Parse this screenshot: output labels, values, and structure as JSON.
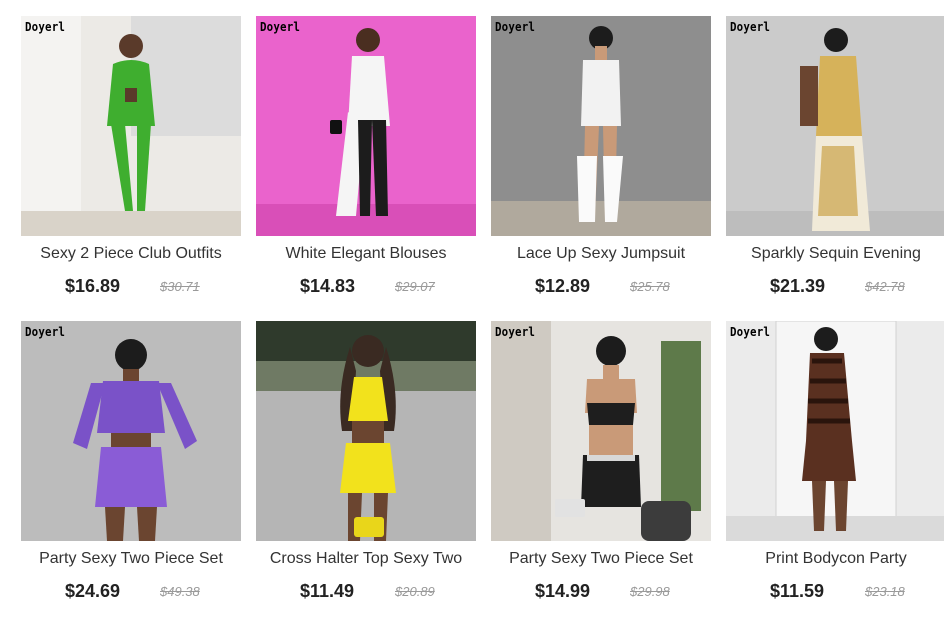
{
  "products": [
    {
      "brand": "Doyerl",
      "title": "Sexy 2 Piece Club Outfits",
      "price": "$16.89",
      "old_price": "$30.71",
      "bg": "#e8e6e3",
      "accent": "#3fae2f",
      "skin": "#5a3a2a"
    },
    {
      "brand": "Doyerl",
      "title": "White Elegant Blouses",
      "price": "$14.83",
      "old_price": "$29.07",
      "bg": "#e85ac8",
      "accent": "#f5f5f5",
      "skin": "#6b4530"
    },
    {
      "brand": "Doyerl",
      "title": "Lace Up Sexy Jumpsuit",
      "price": "$12.89",
      "old_price": "$25.78",
      "bg": "#8c8c8c",
      "accent": "#f2f2f2",
      "skin": "#c99a78"
    },
    {
      "brand": "Doyerl",
      "title": "Sparkly Sequin Evening",
      "price": "$21.39",
      "old_price": "$42.78",
      "bg": "#c9c9c9",
      "accent": "#c9a24a",
      "skin": "#6b4530"
    },
    {
      "brand": "Doyerl",
      "title": "Party Sexy Two Piece Set",
      "price": "$24.69",
      "old_price": "$49.38",
      "bg": "#b8b8b8",
      "accent": "#7a52c8",
      "skin": "#6b4530"
    },
    {
      "brand": "",
      "title": "Cross Halter Top Sexy Two",
      "price": "$11.49",
      "old_price": "$20.89",
      "bg": "#9a9a9a",
      "accent": "#f2e21c",
      "skin": "#6b4530"
    },
    {
      "brand": "Doyerl",
      "title": "Party Sexy Two Piece Set",
      "price": "$14.99",
      "old_price": "$29.98",
      "bg": "#e4e2de",
      "accent": "#1e1e1e",
      "skin": "#c99a78"
    },
    {
      "brand": "Doyerl",
      "title": "Print Bodycon Party",
      "price": "$11.59",
      "old_price": "$23.18",
      "bg": "#e9e9e9",
      "accent": "#5a3020",
      "skin": "#6b4530"
    }
  ]
}
